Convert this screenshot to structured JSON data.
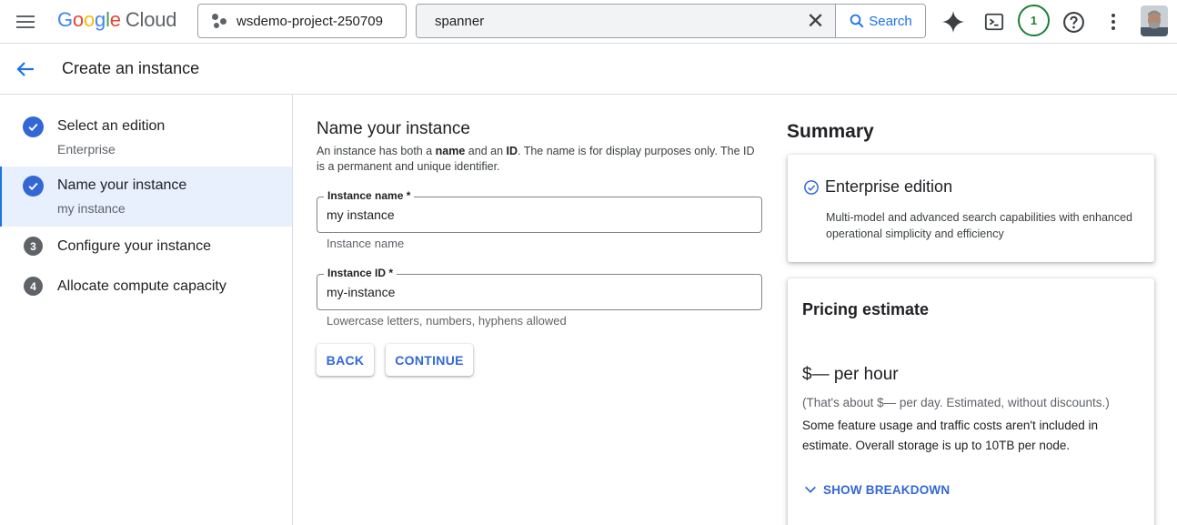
{
  "topbar": {
    "logo_google": [
      "G",
      "o",
      "o",
      "g",
      "l",
      "e"
    ],
    "logo_cloud": "Cloud",
    "project_name": "wsdemo-project-250709",
    "search_value": "spanner",
    "search_button": "Search",
    "notification_count": "1",
    "brand_colors": [
      "#4285f4",
      "#ea4335",
      "#fbbc04",
      "#4285f4",
      "#34a853",
      "#ea4335"
    ]
  },
  "header": {
    "title": "Create an instance"
  },
  "stepper": {
    "steps": [
      {
        "title": "Select an edition",
        "subtitle": "Enterprise",
        "status": "done"
      },
      {
        "title": "Name your instance",
        "subtitle": "my instance",
        "status": "done"
      },
      {
        "number": "3",
        "title": "Configure your instance"
      },
      {
        "number": "4",
        "title": "Allocate compute capacity"
      }
    ]
  },
  "form": {
    "title": "Name your instance",
    "desc_part1": "An instance has both a ",
    "desc_bold1": "name",
    "desc_part2": " and an ",
    "desc_bold2": "ID",
    "desc_part3": ". The name is for display purposes only. The ID is a permanent and unique identifier.",
    "name_label": "Instance name *",
    "name_value": "my instance",
    "name_hint": "Instance name",
    "id_label": "Instance ID *",
    "id_value": "my-instance",
    "id_hint": "Lowercase letters, numbers, hyphens allowed",
    "back_label": "BACK",
    "continue_label": "CONTINUE"
  },
  "summary": {
    "title": "Summary",
    "edition_title": "Enterprise edition",
    "edition_desc": "Multi-model and advanced search capabilities with enhanced operational simplicity and efficiency",
    "pricing_title": "Pricing estimate",
    "pricing_amount": "$— per hour",
    "pricing_note": "(That's about $— per day. Estimated, without discounts.)",
    "pricing_extra": "Some feature usage and traffic costs aren't included in estimate. Overall storage is up to 10TB per node.",
    "breakdown_label": "SHOW BREAKDOWN"
  },
  "colors": {
    "accent": "#1a73e8",
    "step_done": "#3367d6",
    "notification": "#188038"
  }
}
